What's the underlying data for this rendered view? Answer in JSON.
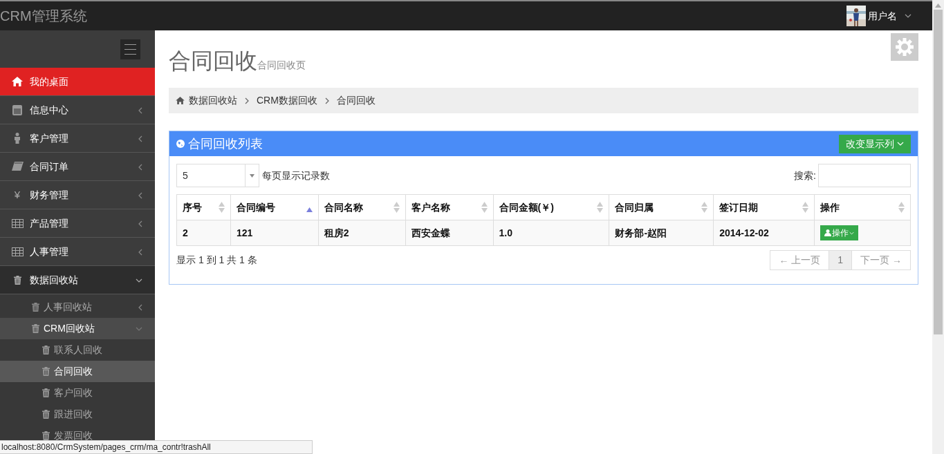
{
  "app_title": "CRM管理系统",
  "user": {
    "name": "用户名"
  },
  "sidebar": {
    "items": [
      {
        "label": "我的桌面",
        "selected": true
      },
      {
        "label": "信息中心",
        "selected": false,
        "expanded": false
      },
      {
        "label": "客户管理",
        "selected": false,
        "expanded": false
      },
      {
        "label": "合同订单",
        "selected": false,
        "expanded": false
      },
      {
        "label": "财务管理",
        "selected": false,
        "expanded": false,
        "glyph": "¥"
      },
      {
        "label": "产品管理",
        "selected": false,
        "expanded": false
      },
      {
        "label": "人事管理",
        "selected": false,
        "expanded": false
      },
      {
        "label": "数据回收站",
        "selected": false,
        "expanded": true,
        "children": [
          {
            "label": "人事回收站",
            "selected": false,
            "expanded": false
          },
          {
            "label": "CRM回收站",
            "selected": false,
            "expanded": true,
            "children": [
              {
                "label": "联系人回收",
                "selected": false
              },
              {
                "label": "合同回收",
                "selected": true
              },
              {
                "label": "客户回收",
                "selected": false
              },
              {
                "label": "跟进回收",
                "selected": false
              },
              {
                "label": "发票回收",
                "selected": false
              }
            ]
          }
        ]
      }
    ]
  },
  "page": {
    "title": "合同回收",
    "subtitle": "合同回收页"
  },
  "breadcrumb": [
    "数据回收站",
    "CRM数据回收",
    "合同回收"
  ],
  "panel": {
    "title": "合同回收列表",
    "columns_button": "改变显示列",
    "page_size": "5",
    "page_size_label": "每页显示记录数",
    "search_label": "搜索:",
    "table": {
      "columns": [
        {
          "label": "序号",
          "sorted": false
        },
        {
          "label": "合同编号",
          "sorted": true
        },
        {
          "label": "合同名称",
          "sorted": false
        },
        {
          "label": "客户名称",
          "sorted": false
        },
        {
          "label": "合同金额(￥)",
          "sorted": false
        },
        {
          "label": "合同归属",
          "sorted": false
        },
        {
          "label": "签订日期",
          "sorted": false
        },
        {
          "label": "操作",
          "sorted": false
        }
      ],
      "rows": [
        {
          "cells": [
            "2",
            "121",
            "租房2",
            "西安金蝶",
            "1.0",
            "财务部-赵阳",
            "2014-12-02"
          ],
          "action": "操作"
        }
      ]
    },
    "info": "显示 1 到 1 共 1 条",
    "pagination": [
      {
        "label": "← 上一页",
        "selected": false,
        "disabled": true
      },
      {
        "label": "1",
        "selected": true,
        "disabled": false
      },
      {
        "label": "下一页 →",
        "selected": false,
        "disabled": true
      }
    ]
  },
  "status_bar": "localhost:8080/CrmSystem/pages_crm/ma_contr!trashAll"
}
